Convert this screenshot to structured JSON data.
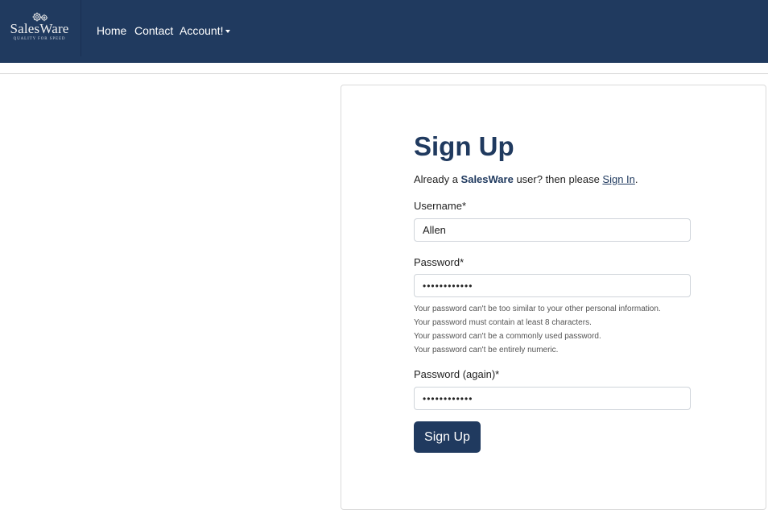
{
  "nav": {
    "brand": {
      "name": "SalesWare",
      "tagline": "QUALITY FOR SPEED",
      "icon": "gears-icon"
    },
    "links": [
      "Home",
      "Contact",
      "Account!"
    ],
    "account_dropdown_icon": "caret-down-icon"
  },
  "form": {
    "title": "Sign Up",
    "intro_prefix": "Already a ",
    "intro_brand": "SalesWare",
    "intro_middle": " user? then please ",
    "intro_link": "Sign In",
    "intro_suffix": ".",
    "username_label": "Username*",
    "username_value": "Allen",
    "password_label": "Password*",
    "password_value": "••••••••••••",
    "password_help": [
      "Your password can't be too similar to your other personal information.",
      "Your password must contain at least 8 characters.",
      "Your password can't be a commonly used password.",
      "Your password can't be entirely numeric."
    ],
    "password_again_label": "Password (again)*",
    "password_again_value": "••••••••••••",
    "submit_label": "Sign Up"
  },
  "colors": {
    "navbar": "#203a5f",
    "accent": "#203a5f"
  }
}
